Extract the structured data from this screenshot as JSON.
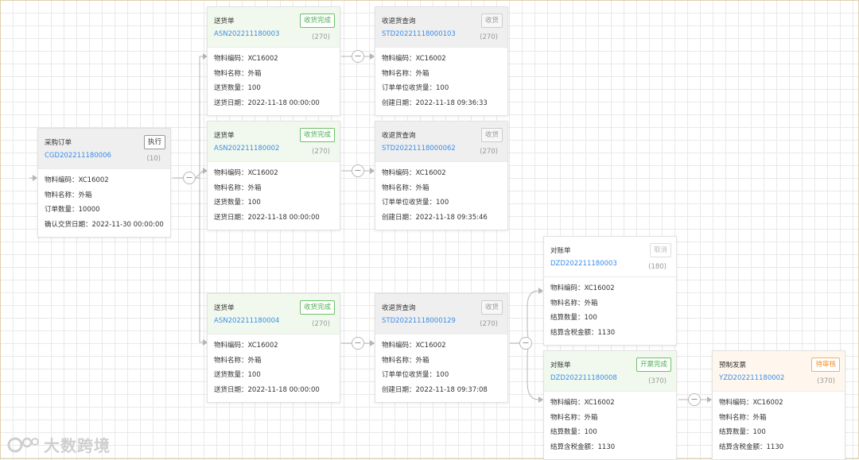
{
  "cards": {
    "po": {
      "type": "采购订单",
      "code": "CGD202211180006",
      "count": "(10)",
      "badge": "执行",
      "rows": [
        {
          "k": "物料编码：",
          "v": "XC16002"
        },
        {
          "k": "物料名称：",
          "v": "外箱"
        },
        {
          "k": "订单数量：",
          "v": "10000"
        },
        {
          "k": "确认交货日期：",
          "v": "2022-11-30 00:00:00"
        }
      ]
    },
    "asn1": {
      "type": "送货单",
      "code": "ASN202211180003",
      "count": "(270)",
      "badge": "收货完成",
      "rows": [
        {
          "k": "物料编码：",
          "v": "XC16002"
        },
        {
          "k": "物料名称：",
          "v": "外箱"
        },
        {
          "k": "送货数量：",
          "v": "100"
        },
        {
          "k": "送货日期：",
          "v": "2022-11-18 00:00:00"
        }
      ]
    },
    "asn2": {
      "type": "送货单",
      "code": "ASN202211180002",
      "count": "(270)",
      "badge": "收货完成",
      "rows": [
        {
          "k": "物料编码：",
          "v": "XC16002"
        },
        {
          "k": "物料名称：",
          "v": "外箱"
        },
        {
          "k": "送货数量：",
          "v": "100"
        },
        {
          "k": "送货日期：",
          "v": "2022-11-18 00:00:00"
        }
      ]
    },
    "asn3": {
      "type": "送货单",
      "code": "ASN202211180004",
      "count": "(270)",
      "badge": "收货完成",
      "rows": [
        {
          "k": "物料编码：",
          "v": "XC16002"
        },
        {
          "k": "物料名称：",
          "v": "外箱"
        },
        {
          "k": "送货数量：",
          "v": "100"
        },
        {
          "k": "送货日期：",
          "v": "2022-11-18 00:00:00"
        }
      ]
    },
    "std1": {
      "type": "收退货查询",
      "code": "STD20221118000103",
      "count": "(270)",
      "badge": "收货",
      "rows": [
        {
          "k": "物料编码：",
          "v": "XC16002"
        },
        {
          "k": "物料名称：",
          "v": "外箱"
        },
        {
          "k": "订单单位收货量：",
          "v": "100"
        },
        {
          "k": "创建日期：",
          "v": "2022-11-18 09:36:33"
        }
      ]
    },
    "std2": {
      "type": "收退货查询",
      "code": "STD20221118000062",
      "count": "(270)",
      "badge": "收货",
      "rows": [
        {
          "k": "物料编码：",
          "v": "XC16002"
        },
        {
          "k": "物料名称：",
          "v": "外箱"
        },
        {
          "k": "订单单位收货量：",
          "v": "100"
        },
        {
          "k": "创建日期：",
          "v": "2022-11-18 09:35:46"
        }
      ]
    },
    "std3": {
      "type": "收退货查询",
      "code": "STD20221118000129",
      "count": "(270)",
      "badge": "收货",
      "rows": [
        {
          "k": "物料编码：",
          "v": "XC16002"
        },
        {
          "k": "物料名称：",
          "v": "外箱"
        },
        {
          "k": "订单单位收货量：",
          "v": "100"
        },
        {
          "k": "创建日期：",
          "v": "2022-11-18 09:37:08"
        }
      ]
    },
    "dzd1": {
      "type": "对账单",
      "code": "DZD202211180003",
      "count": "(180)",
      "badge": "取消",
      "rows": [
        {
          "k": "物料编码：",
          "v": "XC16002"
        },
        {
          "k": "物料名称：",
          "v": "外箱"
        },
        {
          "k": "结算数量：",
          "v": "100"
        },
        {
          "k": "结算含税金额：",
          "v": "1130"
        }
      ]
    },
    "dzd2": {
      "type": "对账单",
      "code": "DZD202211180008",
      "count": "(370)",
      "badge": "开票完成",
      "rows": [
        {
          "k": "物料编码：",
          "v": "XC16002"
        },
        {
          "k": "物料名称：",
          "v": "外箱"
        },
        {
          "k": "结算数量：",
          "v": "100"
        },
        {
          "k": "结算含税金额：",
          "v": "1130"
        }
      ]
    },
    "yzd": {
      "type": "预制发票",
      "code": "YZD202211180002",
      "count": "(370)",
      "badge": "待审核",
      "rows": [
        {
          "k": "物料编码：",
          "v": "XC16002"
        },
        {
          "k": "物料名称：",
          "v": "外箱"
        },
        {
          "k": "结算数量：",
          "v": "100"
        },
        {
          "k": "结算含税金额：",
          "v": "1130"
        }
      ]
    }
  },
  "collapse_symbol": "−",
  "watermark": "大数跨境",
  "colors": {
    "link": "#3a8ee6",
    "success": "#4caf50",
    "warning": "#f0902a",
    "connector": "#b5b5b5"
  }
}
